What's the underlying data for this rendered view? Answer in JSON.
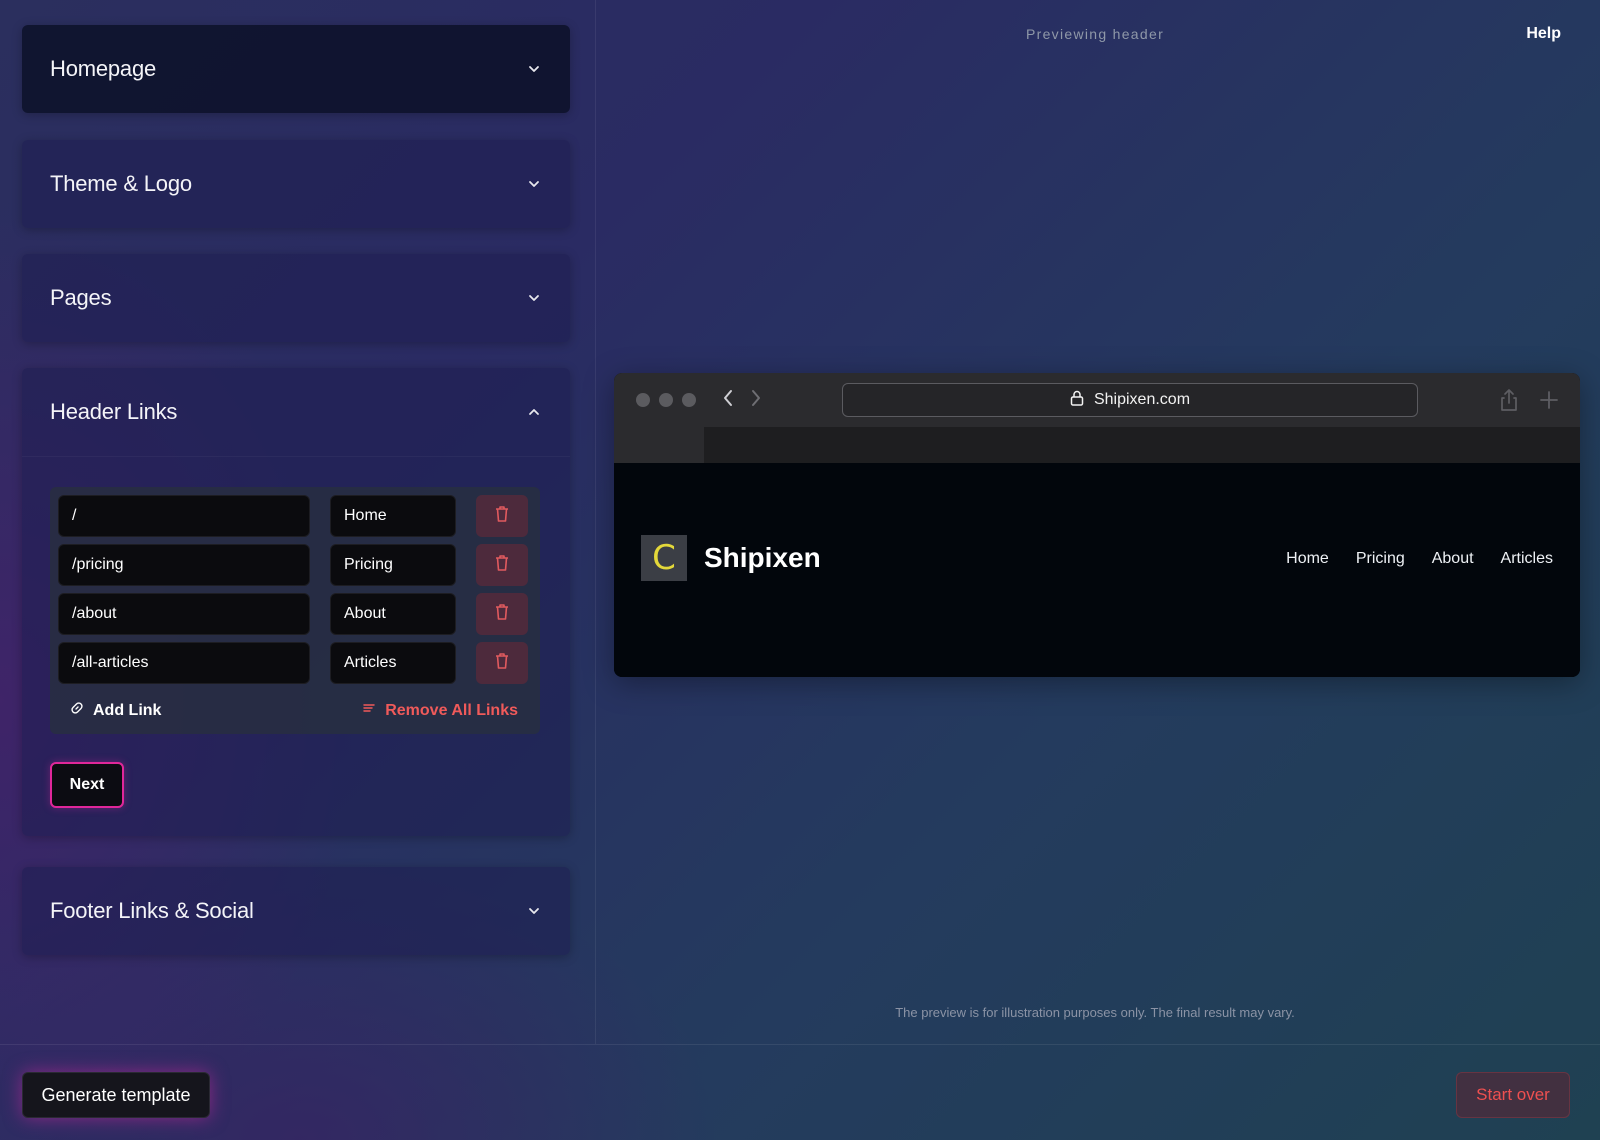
{
  "sections": {
    "homepage": "Homepage",
    "theme_logo": "Theme & Logo",
    "pages": "Pages",
    "header_links": "Header Links",
    "footer_links": "Footer Links & Social"
  },
  "header_links": {
    "rows": [
      {
        "path": "/",
        "label": "Home"
      },
      {
        "path": "/pricing",
        "label": "Pricing"
      },
      {
        "path": "/about",
        "label": "About"
      },
      {
        "path": "/all-articles",
        "label": "Articles"
      }
    ],
    "add_link": "Add Link",
    "remove_all": "Remove All Links",
    "next": "Next"
  },
  "preview": {
    "label": "Previewing header",
    "help": "Help",
    "url": "Shipixen.com",
    "logo_letter": "C",
    "site_name": "Shipixen",
    "nav": [
      "Home",
      "Pricing",
      "About",
      "Articles"
    ],
    "disclaimer": "The preview is for illustration purposes only. The final result may vary."
  },
  "footer": {
    "generate": "Generate template",
    "start_over": "Start over"
  },
  "colors": {
    "accent_pink": "#e0279a",
    "danger_red": "#f05a5a",
    "logo_yellow": "#e3d83a"
  }
}
